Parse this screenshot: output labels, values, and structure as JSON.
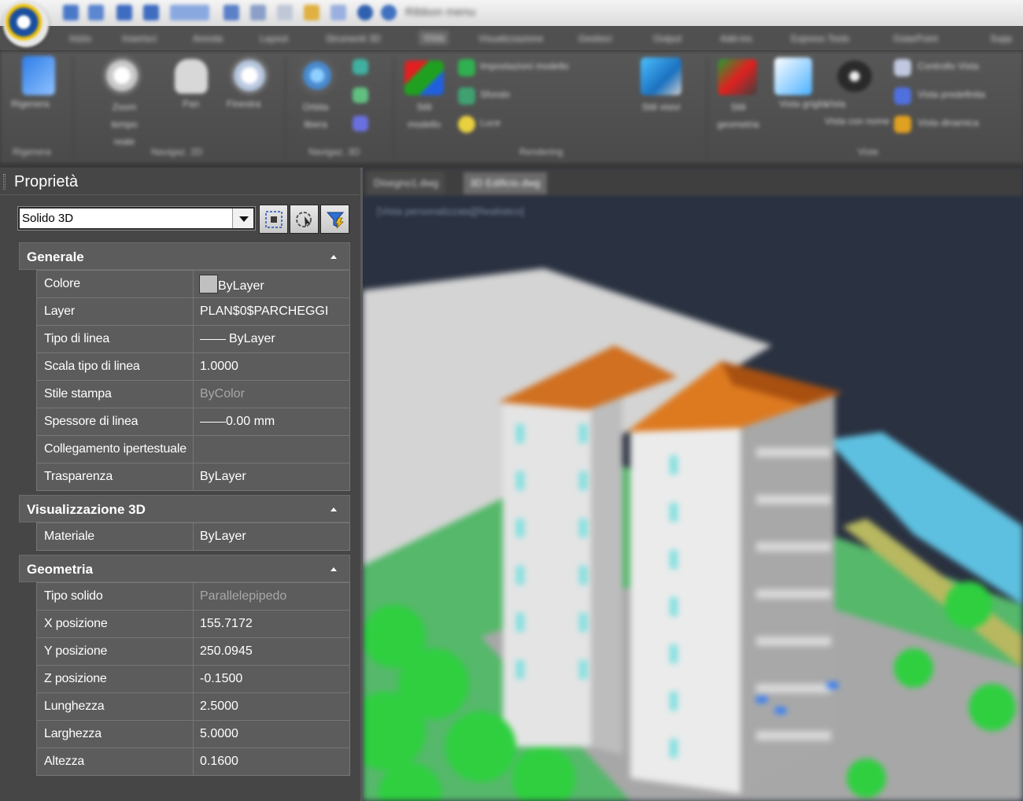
{
  "titlebar": {
    "app_name": "Ribbon menu"
  },
  "menubar": {
    "items": [
      "Inizio",
      "Inserisci",
      "Annota",
      "Layout",
      "Strumenti 3D",
      "Vista",
      "Visualizzazione",
      "Gestisci",
      "Output",
      "Add-ins",
      "Express Tools",
      "GstarPoint",
      "Supp"
    ],
    "active_index": 5
  },
  "ribbon": {
    "groups": [
      "Rigenera",
      "Navigaz. 2D",
      "Navigaz. 3D",
      "Rendering",
      "Viste"
    ],
    "buttons": [
      "Rigenera",
      "Zoom tempo reale",
      "Pan",
      "Finestra",
      "Orbita libera",
      "Stili modello",
      "Impostazioni modello",
      "Sfondo",
      "Luce",
      "Stili visivi",
      "Stili geometria",
      "Vista griglia",
      "Vista",
      "Vista con nome",
      "Controllo Vista",
      "Vista predefinita",
      "Vista dinamica"
    ]
  },
  "properties": {
    "title": "Proprietà",
    "object_type": "Solido 3D",
    "sections": [
      {
        "title": "Generale",
        "rows": [
          {
            "name": "Colore",
            "value": "ByLayer"
          },
          {
            "name": "Layer",
            "value": "PLAN$0$PARCHEGGI"
          },
          {
            "name": "Tipo di linea",
            "value": "ByLayer"
          },
          {
            "name": "Scala tipo di linea",
            "value": "1.0000"
          },
          {
            "name": "Stile stampa",
            "value": "ByColor"
          },
          {
            "name": "Spessore di linea",
            "value": "0.00 mm"
          },
          {
            "name": "Collegamento ipertestuale",
            "value": ""
          },
          {
            "name": "Trasparenza",
            "value": "ByLayer"
          }
        ]
      },
      {
        "title": "Visualizzazione 3D",
        "rows": [
          {
            "name": "Materiale",
            "value": "ByLayer"
          }
        ]
      },
      {
        "title": "Geometria",
        "rows": [
          {
            "name": "Tipo solido",
            "value": "Parallelepipedo"
          },
          {
            "name": "X posizione",
            "value": "155.7172"
          },
          {
            "name": "Y posizione",
            "value": "250.0945"
          },
          {
            "name": "Z posizione",
            "value": "-0.1500"
          },
          {
            "name": "Lunghezza",
            "value": "2.5000"
          },
          {
            "name": "Larghezza",
            "value": "5.0000"
          },
          {
            "name": "Altezza",
            "value": "0.1600"
          }
        ]
      }
    ]
  },
  "viewport": {
    "tabs": [
      "Disegno1.dwg",
      "3D Edificio.dwg"
    ],
    "active_tab": 1,
    "caption": "[Vista personalizzata][Realistico]"
  }
}
